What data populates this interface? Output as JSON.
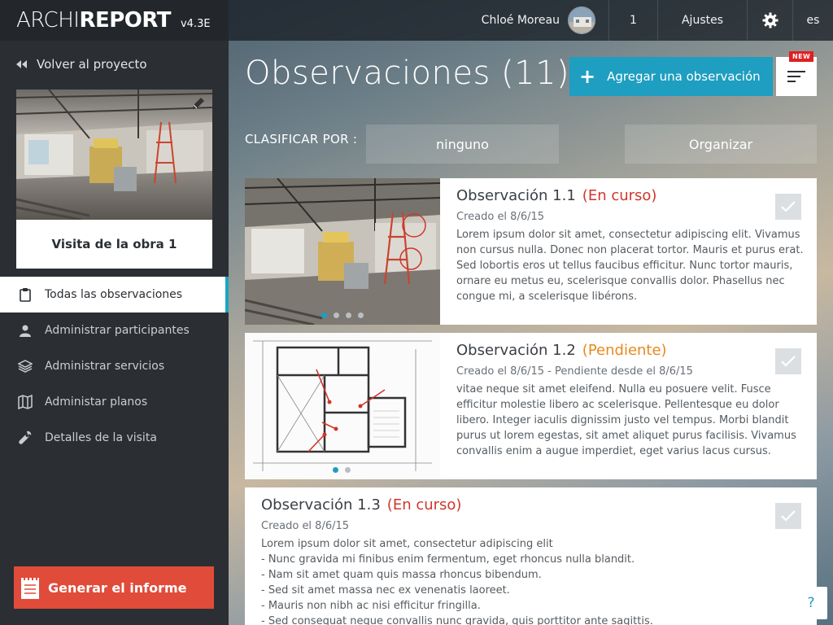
{
  "app": {
    "brand_light": "ARCHI",
    "brand_bold": "REPORT",
    "version": "v4.3E"
  },
  "topbar": {
    "user_name": "Chloé Moreau",
    "notification_count": "1",
    "settings_label": "Ajustes",
    "language": "es"
  },
  "sidebar": {
    "back_label": "Volver al proyecto",
    "visit_name": "Visita de la obra 1",
    "items": [
      {
        "label": "Todas las observaciones",
        "icon": "clipboard-icon",
        "active": true
      },
      {
        "label": "Administrar participantes",
        "icon": "user-icon"
      },
      {
        "label": "Administrar servicios",
        "icon": "layers-icon"
      },
      {
        "label": "Administar planos",
        "icon": "map-icon"
      },
      {
        "label": "Detalles de la visita",
        "icon": "wrench-icon"
      }
    ],
    "generate_label": "Generar el informe"
  },
  "main": {
    "title": "Observaciones (11)",
    "add_label": "Agregar una observación",
    "new_badge": "NEW",
    "classify_label": "CLASIFICAR POR :",
    "classify_value": "ninguno",
    "organize_label": "Organizar"
  },
  "observations": [
    {
      "title": "Observación 1.1",
      "status": "(En curso)",
      "status_kind": "encurso",
      "date": "Creado el 8/6/15",
      "text": "Lorem ipsum dolor sit amet, consectetur adipiscing elit. Vivamus non cursus nulla. Donec non placerat tortor. Mauris et purus erat. Sed lobortis eros ut tellus faucibus efficitur. Nunc tortor mauris, ornare eu metus eu, scelerisque convallis dolor. Phasellus nec congue mi, a scelerisque libérons.",
      "image": "photo",
      "dots": 4,
      "active_dot": 0
    },
    {
      "title": "Observación 1.2",
      "status": "(Pendiente)",
      "status_kind": "pendiente",
      "date": "Creado el 8/6/15 - Pendiente desde el 8/6/15",
      "text": "vitae neque sit amet eleifend. Nulla eu posuere velit. Fusce efficitur molestie libero ac scelerisque. Pellentesque eu dolor libero. Integer iaculis dignissim justo vel tempus. Morbi blandit purus ut lorem egestas, sit amet aliquet purus facilisis. Vivamus convallis enim a augue imperdiet, eget varius lacus cursus.",
      "image": "plan",
      "dots": 2,
      "active_dot": 0
    },
    {
      "title": "Observación 1.3",
      "status": "(En curso)",
      "status_kind": "encurso",
      "date": "Creado el 8/6/15",
      "text": "Lorem ipsum dolor sit amet, consectetur adipiscing elit\n- Nunc gravida mi finibus enim fermentum, eget rhoncus nulla blandit.\n- Nam sit amet quam quis massa rhoncus bibendum.\n- Sed sit amet massa nec ex venenatis laoreet.\n- Mauris non nibh ac nisi efficitur fringilla.\n- Sed consequat neque convallis nunc gravida, quis porttitor ante sagittis.",
      "image": "none"
    }
  ],
  "help_label": "?",
  "colors": {
    "accent": "#1e9ec0",
    "danger": "#e14b3a",
    "in_progress": "#d0362b",
    "pending": "#e8891c",
    "sidebar": "#2b2f33"
  }
}
